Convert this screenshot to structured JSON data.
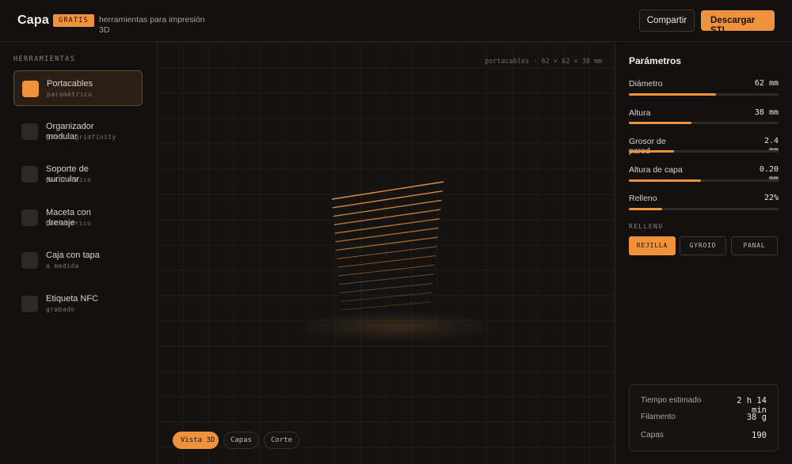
{
  "header": {
    "logo": "Capa",
    "badge": "GRATIS",
    "subtitle": "herramientas para impresión 3D",
    "share_label": "Compartir",
    "download_label": "Descargar STL"
  },
  "sidebar": {
    "title": "HERRAMIENTAS",
    "items": [
      {
        "label": "Portacables",
        "desc": "paramétrico",
        "active": true,
        "icon": "square-icon"
      },
      {
        "label": "Organizador modular",
        "desc": "grid · gridfinity",
        "active": false,
        "icon": "square-icon"
      },
      {
        "label": "Soporte de auricular",
        "desc": "paramétrico",
        "active": false,
        "icon": "square-icon"
      },
      {
        "label": "Maceta con drenaje",
        "desc": "paramétrico",
        "active": false,
        "icon": "square-icon"
      },
      {
        "label": "Caja con tapa",
        "desc": "a medida",
        "active": false,
        "icon": "square-icon"
      },
      {
        "label": "Etiqueta NFC",
        "desc": "grabado",
        "active": false,
        "icon": "square-icon"
      }
    ]
  },
  "viewport": {
    "caption": "portacables · 62 × 62 × 38 mm",
    "tabs": [
      {
        "label": "Vista 3D",
        "active": true
      },
      {
        "label": "Capas",
        "active": false
      },
      {
        "label": "Corte",
        "active": false
      }
    ]
  },
  "panel": {
    "title": "Parámetros",
    "params": [
      {
        "label": "Diámetro",
        "value": "62 mm",
        "fill": 0.58
      },
      {
        "label": "Altura",
        "value": "38 mm",
        "fill": 0.42
      },
      {
        "label": "Grosor de pared",
        "value": "2.4 mm",
        "fill": 0.3
      },
      {
        "label": "Altura de capa",
        "value": "0.20 mm",
        "fill": 0.48
      },
      {
        "label": "Relleno",
        "value": "22%",
        "fill": 0.22
      }
    ],
    "infill_label": "RELLENO",
    "infill_options": [
      {
        "label": "REJILLA",
        "active": true
      },
      {
        "label": "GYROID",
        "active": false
      },
      {
        "label": "PANAL",
        "active": false
      }
    ],
    "stats": [
      {
        "label": "Tiempo estimado",
        "value": "2 h 14 min"
      },
      {
        "label": "Filamento",
        "value": "38 g"
      },
      {
        "label": "Capas",
        "value": "190"
      }
    ]
  },
  "colors": {
    "accent": "#f0913c",
    "background": "#121110",
    "panel_border": "#262422"
  }
}
